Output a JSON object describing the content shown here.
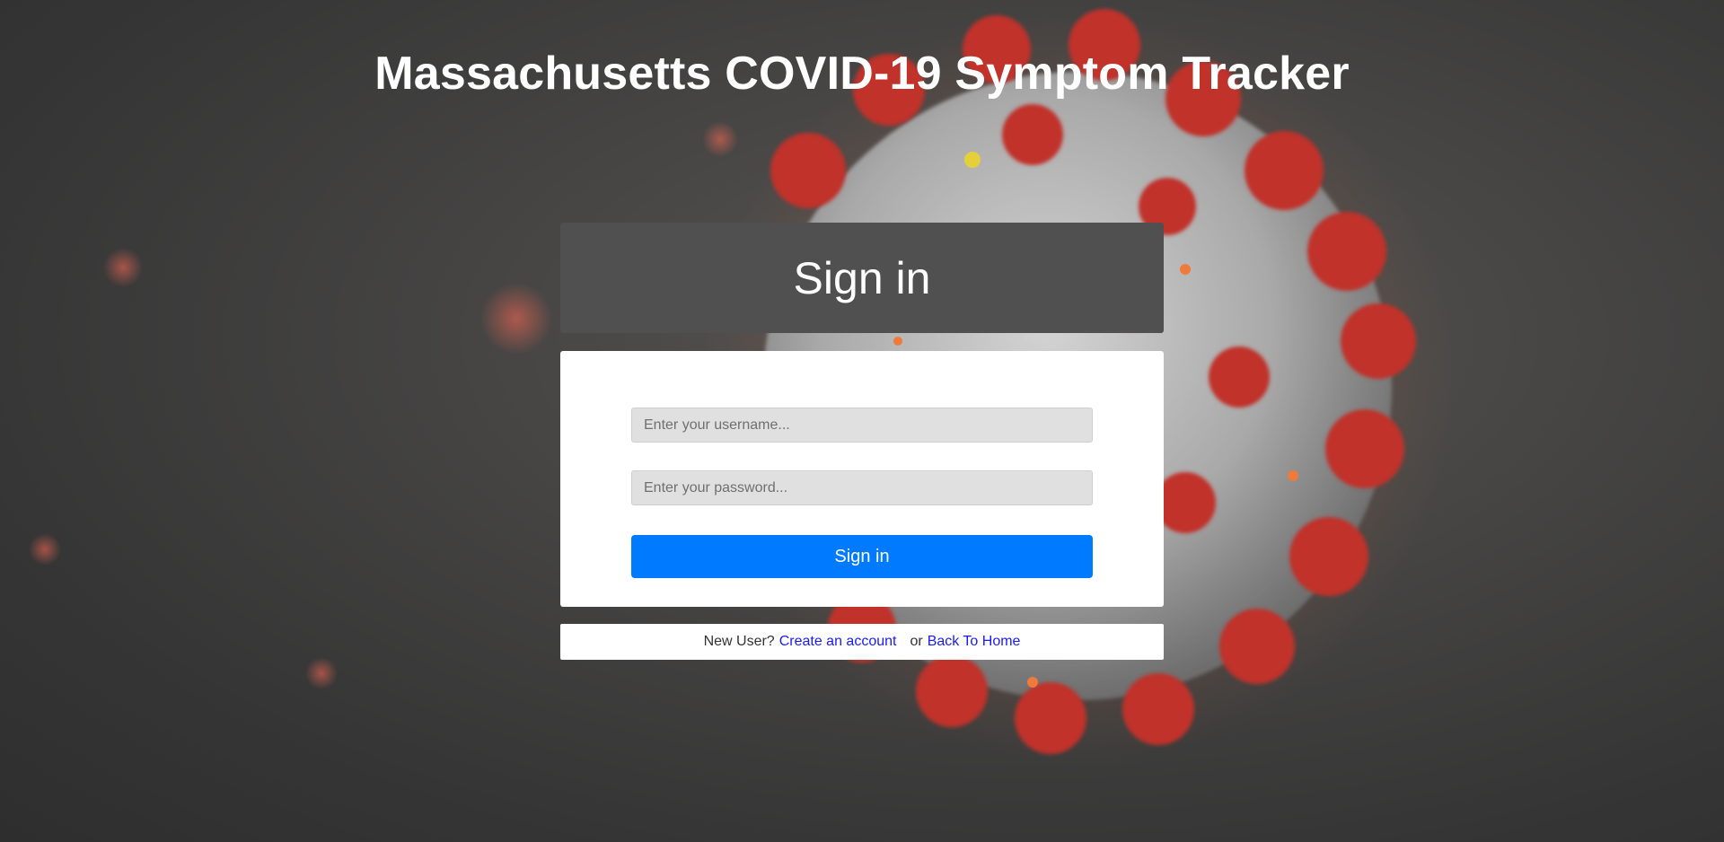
{
  "page": {
    "title": "Massachusetts COVID-19 Symptom Tracker"
  },
  "signin": {
    "header": "Sign in",
    "username_placeholder": "Enter your username...",
    "password_placeholder": "Enter your password...",
    "submit_label": "Sign in"
  },
  "footer": {
    "new_user_text": "New User?",
    "create_account_link": "Create an account",
    "or_text": "or",
    "back_home_link": "Back To Home"
  },
  "icons": {
    "background": "coronavirus-illustration"
  },
  "colors": {
    "primary_button": "#007bff",
    "link": "#1a1aff",
    "header_panel": "#505050",
    "virus_spike": "#c0332b",
    "virus_body": "#b8b8b8"
  }
}
